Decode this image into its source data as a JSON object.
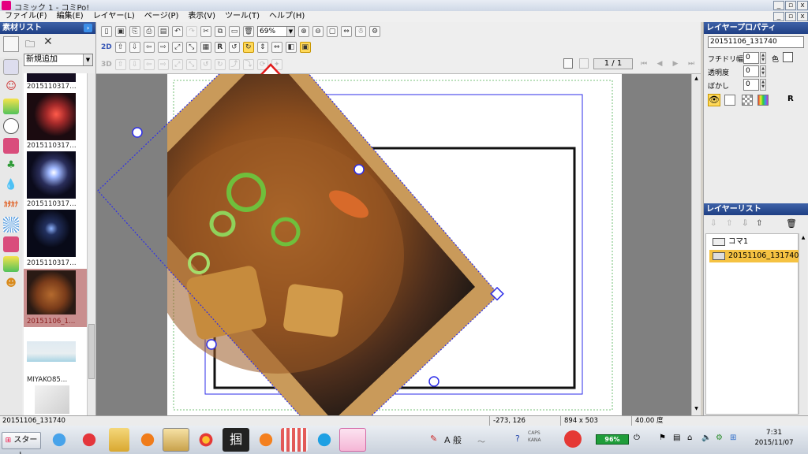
{
  "window": {
    "title": "コミック 1 - コミPo!"
  },
  "menu": [
    "ファイル(F)",
    "編集(E)",
    "レイヤー(L)",
    "ページ(P)",
    "表示(V)",
    "ツール(T)",
    "ヘルプ(H)"
  ],
  "material_list": {
    "title": "素材リスト",
    "dropdown_value": "新規追加",
    "thumbs": [
      {
        "caption": "2015110317…"
      },
      {
        "caption": "2015110317…"
      },
      {
        "caption": "2015110317…"
      },
      {
        "caption": "2015110317…"
      },
      {
        "caption": "20151106_1…"
      },
      {
        "caption": ""
      },
      {
        "caption": "MIYAKO85…"
      }
    ]
  },
  "toolbar": {
    "zoom_value": "69%",
    "label_2d": "2D",
    "label_3d": "3D",
    "page_display": "1 / 1",
    "r_label": "R"
  },
  "layer_properties": {
    "title": "レイヤープロパティ",
    "name_value": "20151106_131740",
    "border_width_label": "フチドリ幅",
    "border_width_value": "0",
    "color_label": "色",
    "opacity_label": "透明度",
    "opacity_value": "0",
    "blur_label": "ぼかし",
    "blur_value": "0",
    "r_label": "R"
  },
  "layer_list": {
    "title": "レイヤーリスト",
    "items": [
      {
        "label": "コマ1",
        "selected": false
      },
      {
        "label": "20151106_131740",
        "selected": true
      }
    ]
  },
  "status": {
    "file": "20151106_131740",
    "coords": "-273, 126",
    "size": "894 x 503",
    "angle": "40.00 度"
  },
  "taskbar": {
    "start_label": "スタート",
    "battery": "96%",
    "time": "7:31",
    "date": "2015/11/07",
    "ime_text": "A 般",
    "caps": "CAPS",
    "kana": "KANA"
  }
}
